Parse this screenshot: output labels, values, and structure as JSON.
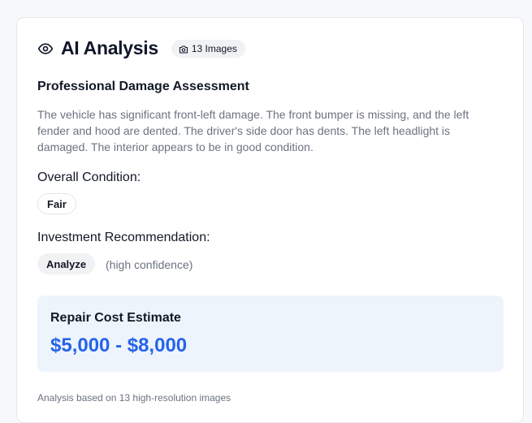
{
  "header": {
    "title": "AI Analysis",
    "images_badge": "13 Images"
  },
  "assessment": {
    "title": "Professional Damage Assessment",
    "summary": "The vehicle has significant front-left damage. The front bumper is missing, and the left fender and hood are dented. The driver's side door has dents. The left headlight is damaged. The interior appears to be in good condition."
  },
  "condition": {
    "label": "Overall Condition:",
    "value": "Fair"
  },
  "recommendation": {
    "label": "Investment Recommendation:",
    "value": "Analyze",
    "confidence": "(high confidence)"
  },
  "repair": {
    "label": "Repair Cost Estimate",
    "value": "$5,000 - $8,000"
  },
  "footer": {
    "note": "Analysis based on 13 high-resolution images"
  },
  "colors": {
    "accent": "#2563eb",
    "estimate_bg": "#eef4fc"
  },
  "icons": {
    "title": "eye-icon",
    "badge": "camera-icon"
  }
}
